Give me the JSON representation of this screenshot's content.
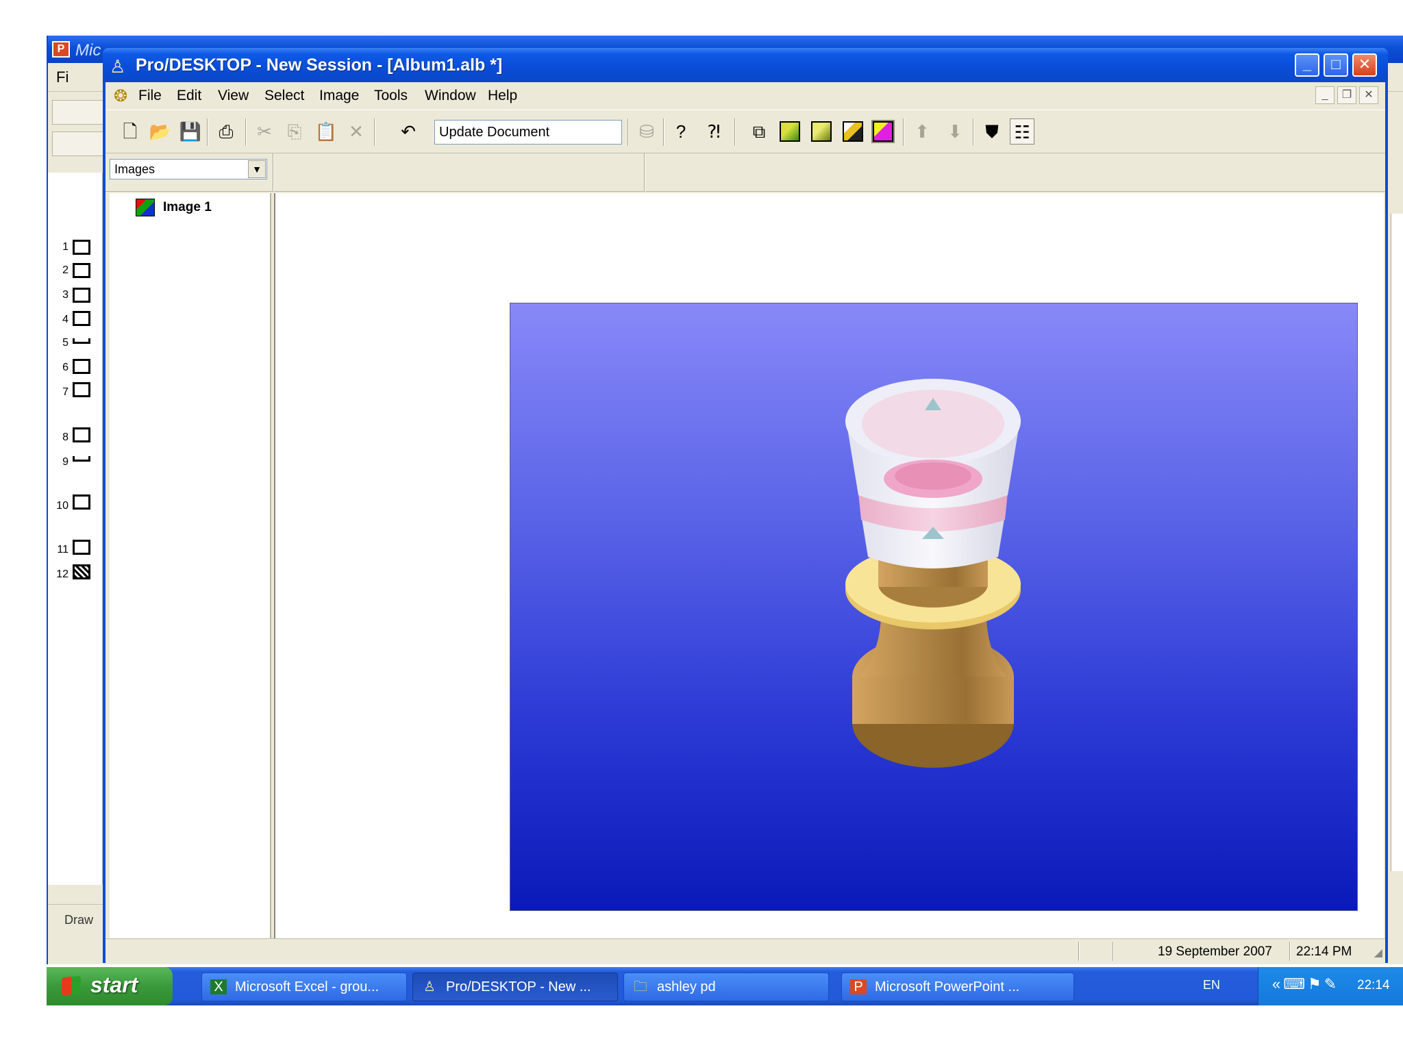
{
  "background_window": {
    "title": "Mic",
    "menu_file": "Fi",
    "slide_numbers": [
      "1",
      "2",
      "3",
      "4",
      "5",
      "6",
      "7",
      "8",
      "9",
      "10",
      "11",
      "12"
    ],
    "draw_label": "Draw"
  },
  "window": {
    "title": "Pro/DESKTOP - New Session - [Album1.alb *]",
    "min_glyph": "_",
    "max_glyph": "□",
    "close_glyph": "✕"
  },
  "menubar": {
    "items": [
      "File",
      "Edit",
      "View",
      "Select",
      "Image",
      "Tools",
      "Window",
      "Help"
    ],
    "mdi_min": "_",
    "mdi_restore": "❐",
    "mdi_close": "✕"
  },
  "toolbar": {
    "update_label": "Update Document",
    "icons": [
      "new-icon",
      "open-icon",
      "save-icon",
      "print-icon",
      "cut-icon",
      "copy-icon",
      "paste-icon",
      "delete-icon",
      "undo-icon",
      "update-document-icon",
      "help-icon",
      "context-help-icon",
      "wireframe-icon",
      "shaded-icon",
      "shaded-edges-icon",
      "hidden-line-icon",
      "render-icon",
      "move-up-icon",
      "move-down-icon",
      "open-album-icon",
      "show-tree-icon"
    ]
  },
  "browser": {
    "selected": "Images",
    "items": [
      "Image 1"
    ]
  },
  "render": {
    "description_colors": {
      "background_top": "#8888f8",
      "background_bottom": "#0a1ab8",
      "wood": "#b88a44",
      "glass": "#f2f0fa",
      "pink": "#f0a6c8",
      "ring": "#f6e088"
    }
  },
  "status": {
    "date": "19 September 2007",
    "time": "22:14 PM"
  },
  "taskbar": {
    "start_label": "start",
    "tasks": [
      {
        "label": "Microsoft Excel - grou...",
        "icon": "excel-icon",
        "active": false
      },
      {
        "label": "Pro/DESKTOP - New ...",
        "icon": "prodesktop-icon",
        "active": true
      },
      {
        "label": "ashley pd",
        "icon": "folder-icon",
        "active": false
      },
      {
        "label": "Microsoft PowerPoint ...",
        "icon": "powerpoint-icon",
        "active": false
      }
    ],
    "language": "EN",
    "clock": "22:14"
  }
}
